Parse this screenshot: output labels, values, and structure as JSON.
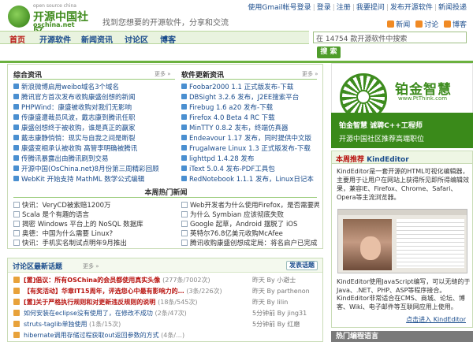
{
  "header": {
    "logo_top": "open source china",
    "logo_main": "开源中国社区",
    "logo_url": "oschina.net",
    "slogan": "找到您想要的开源软件，分享和交流",
    "top_links": [
      "使用Gmail帐号登录",
      "登录",
      "注册",
      "我要提问",
      "发布开源软件",
      "新闻投递"
    ],
    "sub_links": [
      "新闻",
      "讨论",
      "博客"
    ]
  },
  "nav": {
    "tabs": [
      "首页",
      "开源软件",
      "新闻资讯",
      "讨论区",
      "博客"
    ],
    "search_placeholder": "在 14754 款开源软件中搜索",
    "search_button": "搜 索"
  },
  "news": {
    "title": "综合资讯",
    "more": "更多 »",
    "items": [
      "新浪微博启用weibo域名3个域名",
      "腾讯官方首次发布收购康盛创想的新闻",
      "PHPWind：康盛被收购对我们无影响",
      "传康盛遭裁员风波，戴志康到腾讯任职",
      "康盛创想终于被收购，谁是真正的赢家",
      "戴志康静悄悄：现实与自我之间是断裂",
      "康盛变相承认被收购 高管李明确被腾讯",
      "传腾讯暴露出由腾讯刷到交易",
      "开源中国(OsChina.net)8月份第三周精彩回顾",
      "WebKit 开始支持 MathML 数学公式编辑"
    ]
  },
  "software": {
    "title": "软件更新资讯",
    "more": "更多 »",
    "items": [
      "Foobar2000 1.1 正式版发布-下载",
      "DBSight 3.2.6 发布，J2EE搜索平台",
      "Firebug 1.6 a20 发布-下载",
      "Firefox 4.0 Beta 4 RC 下载",
      "MinTTY 0.8.2 发布，终端仿真器",
      "Endeavour 1.17 发布，同时提供中文版",
      "Frugalware Linux 1.3 正式版发布-下载",
      "lighttpd 1.4.28 发布",
      "iText 5.0.4 发布-PDF工具包",
      "RedNotebook 1.1.1 发布，Linux日记本"
    ]
  },
  "hot": {
    "title": "本周热门新闻",
    "left": [
      "快讯：VeryCD被索赔1200万",
      "Scala 是个有趣的语言",
      "揭密 Windows 平台上的 NoSQL 数据库",
      "奥德：中国为什么需要 Linux?",
      "快讯：手机实名制试点明年9月推出"
    ],
    "right": [
      "Web开发者为什么使用Firefox，是否需要两个浏览器",
      "为什么 Symbian 应该彻底失败",
      "Google 起草，Android 摆脱了 iOS",
      "英特尔76.8亿美元收购McAfee",
      "腾讯收购康盛创想成定局：将名启户已完成"
    ]
  },
  "forum": {
    "title": "讨论区最新话题",
    "more": "更多 »",
    "post_button": "发表话题",
    "rows": [
      {
        "title": "[置]倡议：所有OSChina的会员都使用真实头像",
        "counts": "(277条/7002次)",
        "author": "昨天 By 小避士",
        "red": true
      },
      {
        "title": "【有奖活动】华章IT15周年，评选您心中最有影响力的…",
        "counts": "(3条/226次)",
        "author": "昨天 By parthenon",
        "red": true
      },
      {
        "title": "[置]关于严格执行规则和对更新违反规则的说明",
        "counts": "(18条/545次)",
        "author": "昨天 By lilin",
        "red": true
      },
      {
        "title": "如何安装在eclipse没有使用了，在修改不成功",
        "counts": "(2条/47次)",
        "author": "5分钟前 By jing31",
        "red": false
      },
      {
        "title": "struts-taglib单独使用",
        "counts": "(1条/15次)",
        "author": "5分钟前 By 红磨",
        "red": false
      },
      {
        "title": "hibernate调用存储过程获取out返回参数的方式",
        "counts": "(4条/…)",
        "author": "",
        "red": false
      }
    ]
  },
  "right": {
    "ad_brand": "铂金智慧",
    "ad_url": "www.PtThink.com",
    "banner_line1": "铂金智慧  诚聘C++工程师",
    "banner_line2": "开源中国社区推荐高端职位",
    "rec_title": "本周推荐",
    "rec_name": "KindEditor",
    "rec_intro": "KindEditor是一套开源的HTML可视化编辑器，主要用于让用户在网站上获得所见即所得编辑效果，兼容IE、Firefox、Chrome、Safari、Opera等主流浏览器。",
    "rec_desc": "KindEditor使用JavaScript编写，可以无缝的于Java、.NET、PHP、ASP等程序接合。KindEditor非常适合在CMS、商城、论坛、博客、Wiki、电子邮件等互联网应用上使用。",
    "rec_link": "点击进入 KindEditor",
    "bottom_tab": "热门编程语言"
  }
}
